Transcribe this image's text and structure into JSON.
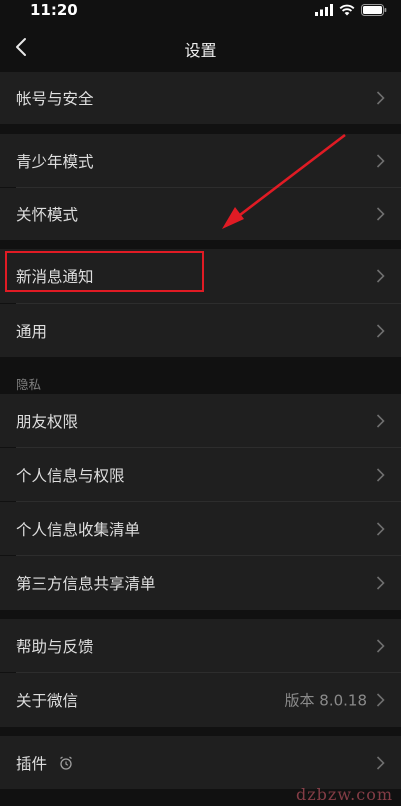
{
  "status_bar": {
    "time": "11:20",
    "icons": [
      "signal-icon",
      "wifi-icon",
      "battery-icon"
    ]
  },
  "nav": {
    "title": "设置",
    "back_icon": "chevron-left-icon"
  },
  "rows": {
    "account_security": "帐号与安全",
    "youth_mode": "青少年模式",
    "care_mode": "关怀模式",
    "new_message_notification": "新消息通知",
    "general": "通用",
    "privacy_section": "隐私",
    "friend_permissions": "朋友权限",
    "personal_info_permissions": "个人信息与权限",
    "personal_info_collection": "个人信息收集清单",
    "third_party_sharing": "第三方信息共享清单",
    "help_feedback": "帮助与反馈",
    "about_wechat": "关于微信",
    "about_version": "版本 8.0.18",
    "plugins": "插件"
  },
  "colors": {
    "background": "#111111",
    "row_background": "#1f1f1f",
    "text": "#dedede",
    "secondary_text": "#8a8a8a",
    "annotation_red": "#e01b24"
  },
  "annotation": {
    "highlighted_item": "新消息通知",
    "arrow": "red-arrow-icon"
  },
  "watermark": "dzbzw.com"
}
